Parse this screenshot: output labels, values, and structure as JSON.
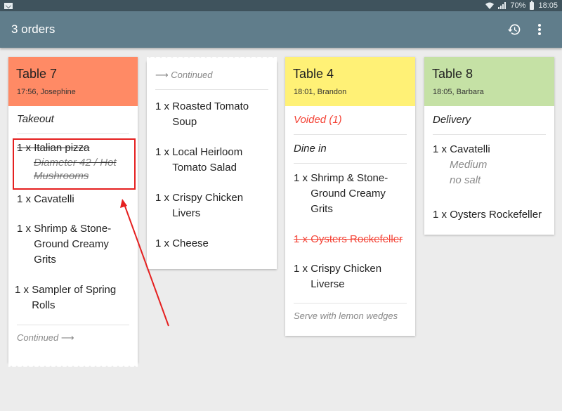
{
  "status_bar": {
    "notification_icon": "mail-icon",
    "battery_percent": "70%",
    "time": "18:05"
  },
  "app_bar": {
    "title": "3 orders",
    "actions": [
      {
        "icon": "history-icon",
        "label": "History"
      },
      {
        "icon": "more-vert-icon",
        "label": "More options"
      }
    ]
  },
  "colors": {
    "app_bar": "#607d8b",
    "status_bar": "#3f535d",
    "table7_header": "#ff8a65",
    "table4_header": "#fff176",
    "table8_header": "#c5e1a5",
    "voided": "#f44336",
    "annotation": "#e52020"
  },
  "orders": [
    {
      "table": "Table 7",
      "meta": "17:56, Josephine",
      "header_color": "#ff8a65",
      "section": "Takeout",
      "items": [
        {
          "qty": "1 x ",
          "name": "Italian pizza",
          "modifiers": [
            "Diameter 42 / Hot Mushrooms"
          ],
          "struck": true
        },
        {
          "qty": "1 x ",
          "name": "Cavatelli"
        },
        {
          "qty": "1 x ",
          "name": "Shrimp & Stone-Ground Creamy Grits"
        },
        {
          "qty": "1 x ",
          "name": "Sampler of Spring Rolls"
        }
      ],
      "continued_label": "Continued ⟶"
    },
    {
      "continued_from_label": "⟶ Continued",
      "items": [
        {
          "qty": "1 x ",
          "name": "Roasted Tomato Soup"
        },
        {
          "qty": "1 x ",
          "name": "Local Heirloom Tomato Salad"
        },
        {
          "qty": "1 x ",
          "name": "Crispy Chicken Livers"
        },
        {
          "qty": "1 x ",
          "name": "Cheese"
        }
      ]
    },
    {
      "table": "Table 4",
      "meta": "18:01, Brandon",
      "header_color": "#fff176",
      "voided_label": "Voided (1)",
      "section": "Dine in",
      "items": [
        {
          "qty": "1 x ",
          "name": "Shrimp & Stone-Ground Creamy Grits"
        },
        {
          "qty": "1 x ",
          "name": "Oysters Rockefeller",
          "voided": true
        },
        {
          "qty": "1 x ",
          "name": "Crispy Chicken Liverse"
        }
      ],
      "note": "Serve with lemon wedges"
    },
    {
      "table": "Table 8",
      "meta": "18:05, Barbara",
      "header_color": "#c5e1a5",
      "section": "Delivery",
      "items": [
        {
          "qty": "1 x ",
          "name": "Cavatelli",
          "modifiers": [
            "Medium",
            "no salt"
          ]
        },
        {
          "qty": "1 x ",
          "name": "Oysters Rockefeller"
        }
      ]
    }
  ]
}
